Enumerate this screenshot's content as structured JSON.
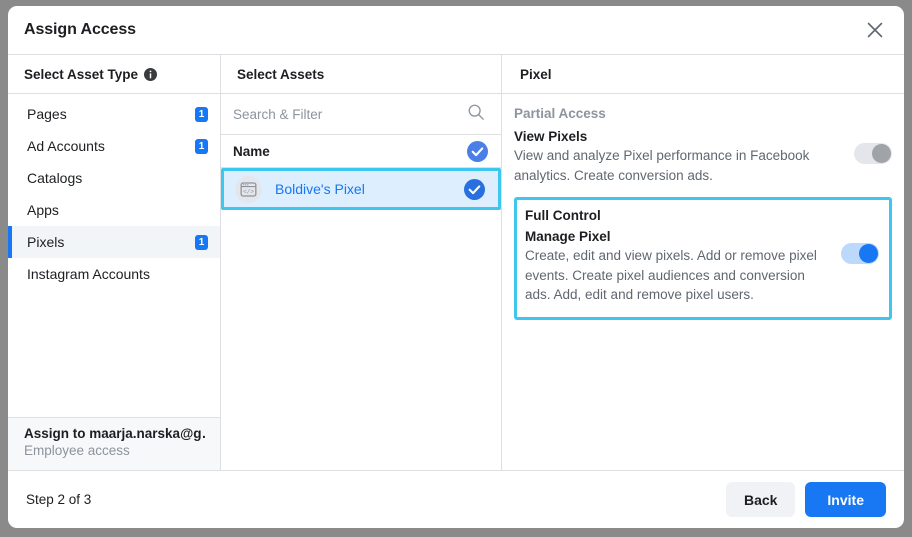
{
  "dialog": {
    "title": "Assign Access",
    "close_icon": "close-icon"
  },
  "asset_type_column": {
    "header": "Select Asset Type",
    "info_icon": "info-icon",
    "items": [
      {
        "label": "Pages",
        "badge": "1",
        "selected": false
      },
      {
        "label": "Ad Accounts",
        "badge": "1",
        "selected": false
      },
      {
        "label": "Catalogs",
        "badge": "",
        "selected": false
      },
      {
        "label": "Apps",
        "badge": "",
        "selected": false
      },
      {
        "label": "Pixels",
        "badge": "1",
        "selected": true
      },
      {
        "label": "Instagram Accounts",
        "badge": "",
        "selected": false
      }
    ],
    "assign_to": {
      "title": "Assign to maarja.narska@g…",
      "subtitle": "Employee access"
    }
  },
  "assets_column": {
    "header": "Select Assets",
    "search": {
      "value": "",
      "placeholder": "Search & Filter",
      "icon": "search-icon"
    },
    "name_header": "Name",
    "name_header_checked": true,
    "rows": [
      {
        "name": "Boldive's Pixel",
        "icon": "pixel-code-icon",
        "checked": true,
        "highlighted": true
      }
    ]
  },
  "permissions_column": {
    "header": "Pixel",
    "groups": [
      {
        "title": "Partial Access",
        "boxed": false,
        "permissions": [
          {
            "name": "View Pixels",
            "description": "View and analyze Pixel performance in Facebook analytics. Create conversion ads.",
            "enabled": false
          }
        ]
      },
      {
        "title": "Full Control",
        "boxed": true,
        "permissions": [
          {
            "name": "Manage Pixel",
            "description": "Create, edit and view pixels. Add or remove pixel events. Create pixel audiences and conversion ads. Add, edit and remove pixel users.",
            "enabled": true
          }
        ]
      }
    ]
  },
  "footer": {
    "step_label": "Step 2 of 3",
    "back_label": "Back",
    "invite_label": "Invite"
  },
  "colors": {
    "accent_blue": "#1877f2",
    "highlight_cyan": "#3ec6ef",
    "highlight_bg": "#ddeeff",
    "selected_row_bg": "#f2f5f7",
    "text_primary": "#1c1e21",
    "text_secondary": "#606770",
    "text_muted": "#8d949e",
    "divider": "#dddfe2",
    "backdrop": "#8a8a8a"
  }
}
